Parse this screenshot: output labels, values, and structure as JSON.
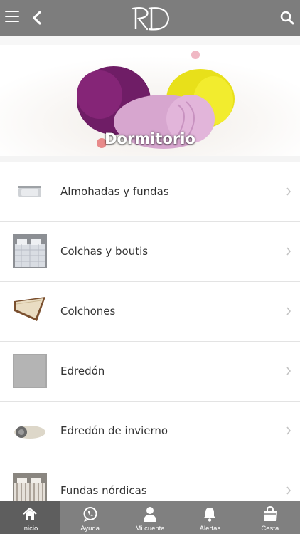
{
  "header": {
    "logo_text": "RD"
  },
  "hero": {
    "title": "Dormitorio"
  },
  "categories": [
    {
      "label": "Almohadas y fundas",
      "icon": "pillow-thumbnail"
    },
    {
      "label": "Colchas y boutis",
      "icon": "bedspread-thumbnail"
    },
    {
      "label": "Colchones",
      "icon": "mattress-thumbnail"
    },
    {
      "label": "Edredón",
      "icon": "duvet-thumbnail"
    },
    {
      "label": "Edredón de invierno",
      "icon": "winter-duvet-thumbnail"
    },
    {
      "label": "Fundas nórdicas",
      "icon": "duvet-cover-thumbnail"
    }
  ],
  "tabbar": {
    "items": [
      {
        "label": "Inicio",
        "icon": "home-icon",
        "active": true
      },
      {
        "label": "Ayuda",
        "icon": "whatsapp-icon",
        "active": false
      },
      {
        "label": "Mi cuenta",
        "icon": "user-icon",
        "active": false
      },
      {
        "label": "Alertas",
        "icon": "bell-icon",
        "active": false
      },
      {
        "label": "Cesta",
        "icon": "shopping-bag-icon",
        "active": false
      }
    ]
  },
  "colors": {
    "header_bg": "#7d7d7d",
    "tabbar_bg": "#808080",
    "tab_active_bg": "#5e5e5e",
    "row_bg": "#ffffff"
  }
}
